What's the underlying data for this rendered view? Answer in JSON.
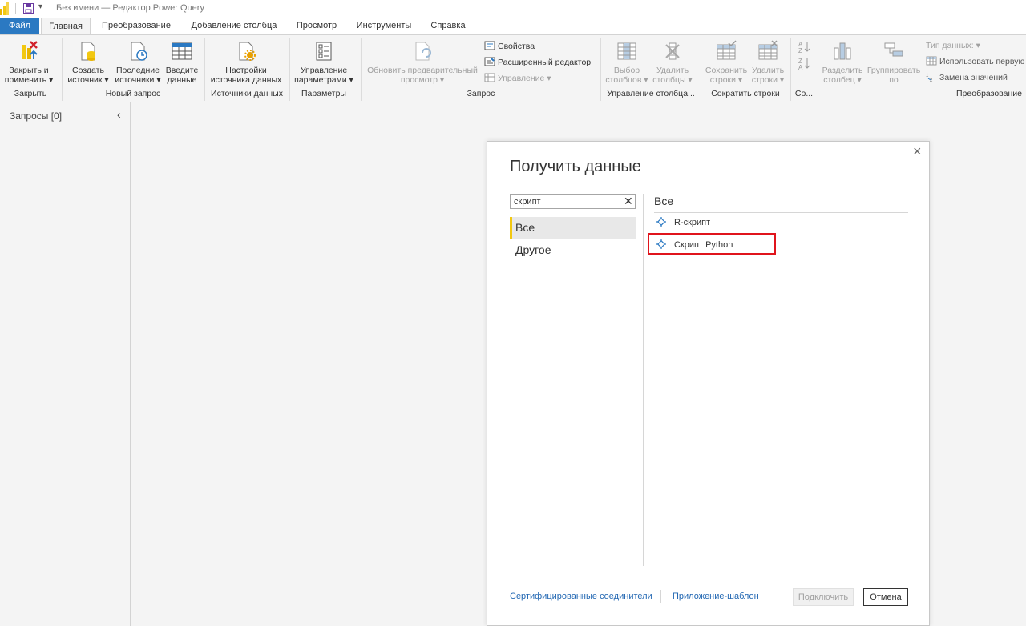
{
  "window": {
    "title": "Без имени — Редактор Power Query"
  },
  "tabs": [
    {
      "label": "Файл",
      "style": "file"
    },
    {
      "label": "Главная",
      "style": "active"
    },
    {
      "label": "Преобразование",
      "style": ""
    },
    {
      "label": "Добавление столбца",
      "style": ""
    },
    {
      "label": "Просмотр",
      "style": ""
    },
    {
      "label": "Инструменты",
      "style": ""
    },
    {
      "label": "Справка",
      "style": ""
    }
  ],
  "ribbon": {
    "close_apply": {
      "line1": "Закрыть и",
      "line2": "применить ▾"
    },
    "new_source": {
      "line1": "Создать",
      "line2": "источник ▾"
    },
    "recent_sources": {
      "line1": "Последние",
      "line2": "источники ▾"
    },
    "enter_data": {
      "line1": "Введите",
      "line2": "данные"
    },
    "data_source_settings": {
      "line1": "Настройки",
      "line2": "источника данных"
    },
    "manage_parameters": {
      "line1": "Управление",
      "line2": "параметрами ▾"
    },
    "refresh_preview": {
      "line1": "Обновить предварительный",
      "line2": "просмотр ▾"
    },
    "properties": "Свойства",
    "advanced_editor": "Расширенный редактор",
    "manage": "Управление ▾",
    "choose_columns": {
      "line1": "Выбор",
      "line2": "столбцов ▾"
    },
    "remove_columns": {
      "line1": "Удалить",
      "line2": "столбцы ▾"
    },
    "keep_rows": {
      "line1": "Сохранить",
      "line2": "строки ▾"
    },
    "remove_rows": {
      "line1": "Удалить",
      "line2": "строки ▾"
    },
    "split_column": {
      "line1": "Разделить",
      "line2": "столбец ▾"
    },
    "group_by": {
      "line1": "Группировать",
      "line2": "по"
    },
    "data_type": "Тип данных: ▾",
    "use_first_row": "Использовать первую",
    "replace_values": "Замена значений",
    "groups": {
      "close": "Закрыть",
      "new_query": "Новый запрос",
      "data_sources": "Источники данных",
      "parameters": "Параметры",
      "query": "Запрос",
      "manage_columns": "Управление столбца...",
      "reduce_rows": "Сократить строки",
      "sort": "Со...",
      "transform": "Преобразование"
    }
  },
  "queries_pane": {
    "label": "Запросы [0]",
    "collapse_icon": "chevron-left-icon"
  },
  "dialog": {
    "title": "Получить данные",
    "search_value": "скрипт",
    "categories": [
      {
        "label": "Все",
        "selected": true
      },
      {
        "label": "Другое",
        "selected": false
      }
    ],
    "results_header": "Все",
    "results": [
      {
        "label": "R-скрипт"
      },
      {
        "label": "Скрипт Python"
      }
    ],
    "highlight_color": "#e0141c",
    "links": {
      "certified": "Сертифицированные соединители",
      "template": "Приложение-шаблон"
    },
    "buttons": {
      "connect": "Подключить",
      "cancel": "Отмена"
    }
  },
  "colors": {
    "file_tab": "#2b79c2",
    "accent_yellow": "#f2c811",
    "link": "#2368b3"
  }
}
